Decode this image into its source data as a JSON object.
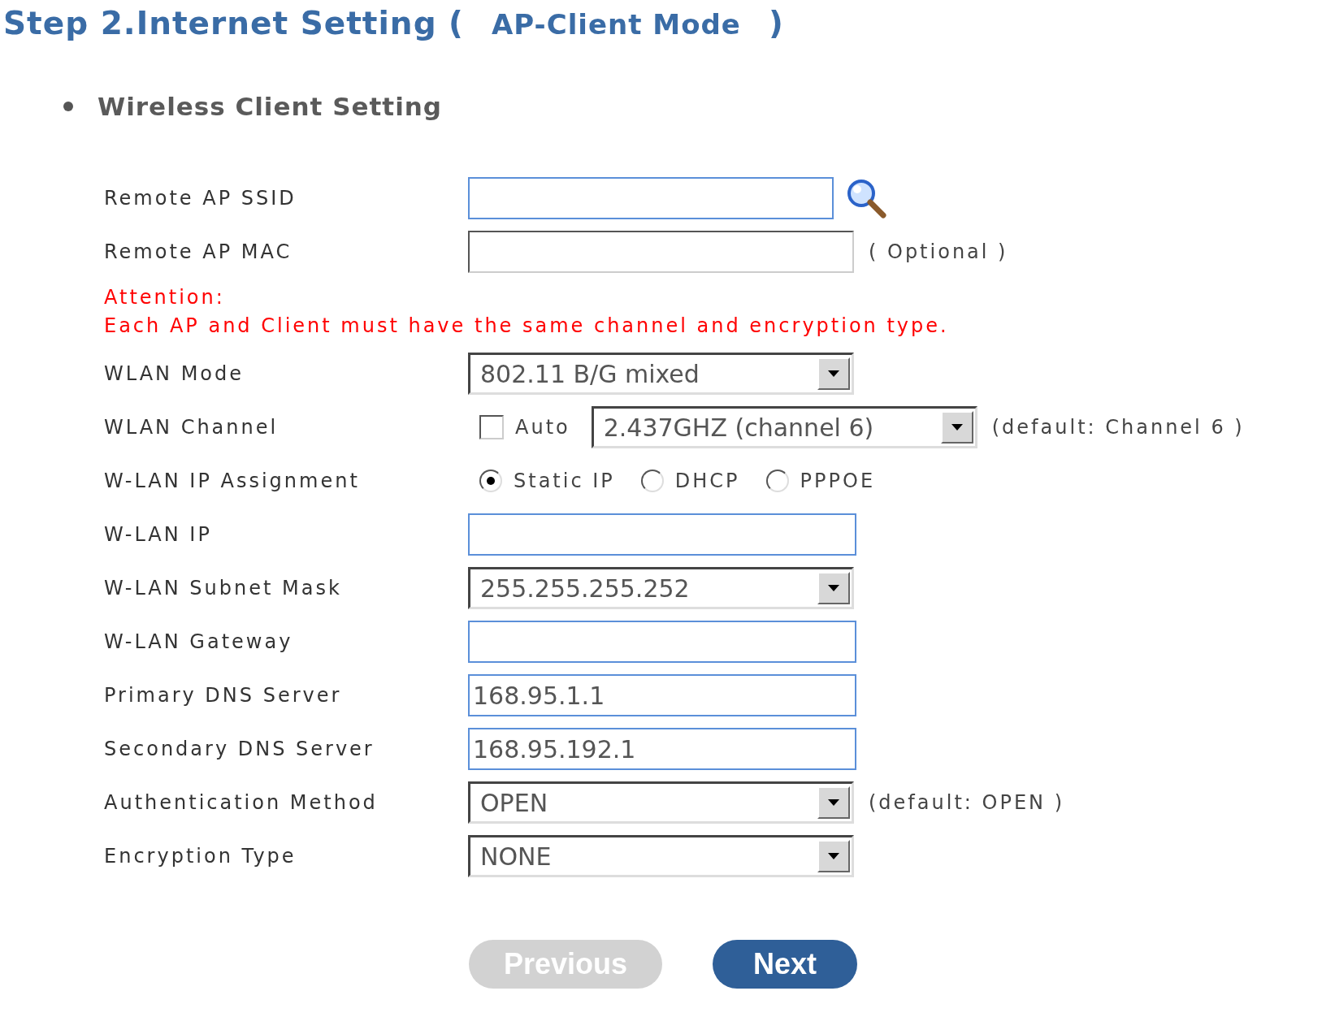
{
  "title": {
    "prefix": "Step 2.Internet Setting (",
    "mode": "AP-Client Mode",
    "suffix": ")"
  },
  "section": "Wireless Client Setting",
  "rows": [
    {
      "kind": "input",
      "label": "Remote AP SSID",
      "search_button": true
    },
    {
      "kind": "sunken_input",
      "label": "Remote AP MAC",
      "note": "( Optional )"
    },
    {
      "kind": "attention",
      "heading": "Attention:",
      "text": "Each AP and Client must have the same channel and encryption type."
    },
    {
      "kind": "select",
      "label": "WLAN Mode",
      "value": "802.11 B/G mixed"
    },
    {
      "kind": "channel",
      "label": "WLAN Channel",
      "auto": {
        "label": "Auto",
        "checked": false
      },
      "value": "2.437GHZ (channel 6)",
      "note": "(default: Channel 6 )"
    },
    {
      "kind": "radio",
      "label": "W-LAN IP Assignment",
      "options": [
        {
          "label": "Static IP",
          "selected": true
        },
        {
          "label": "DHCP",
          "selected": false
        },
        {
          "label": "PPPOE",
          "selected": false
        }
      ]
    },
    {
      "kind": "input",
      "label": "W-LAN IP"
    },
    {
      "kind": "select",
      "label": "W-LAN Subnet Mask",
      "value": "255.255.255.252"
    },
    {
      "kind": "input",
      "label": "W-LAN Gateway"
    },
    {
      "kind": "input",
      "label": "Primary DNS Server",
      "value": "168.95.1.1"
    },
    {
      "kind": "input",
      "label": "Secondary DNS Server",
      "value": "168.95.192.1"
    },
    {
      "kind": "select",
      "label": "Authentication Method",
      "value": "OPEN",
      "note": "(default: OPEN )"
    },
    {
      "kind": "select",
      "label": "Encryption Type",
      "value": "NONE"
    }
  ],
  "buttons": [
    {
      "label": "Previous",
      "disabled": true
    },
    {
      "label": "Next",
      "disabled": false
    }
  ]
}
